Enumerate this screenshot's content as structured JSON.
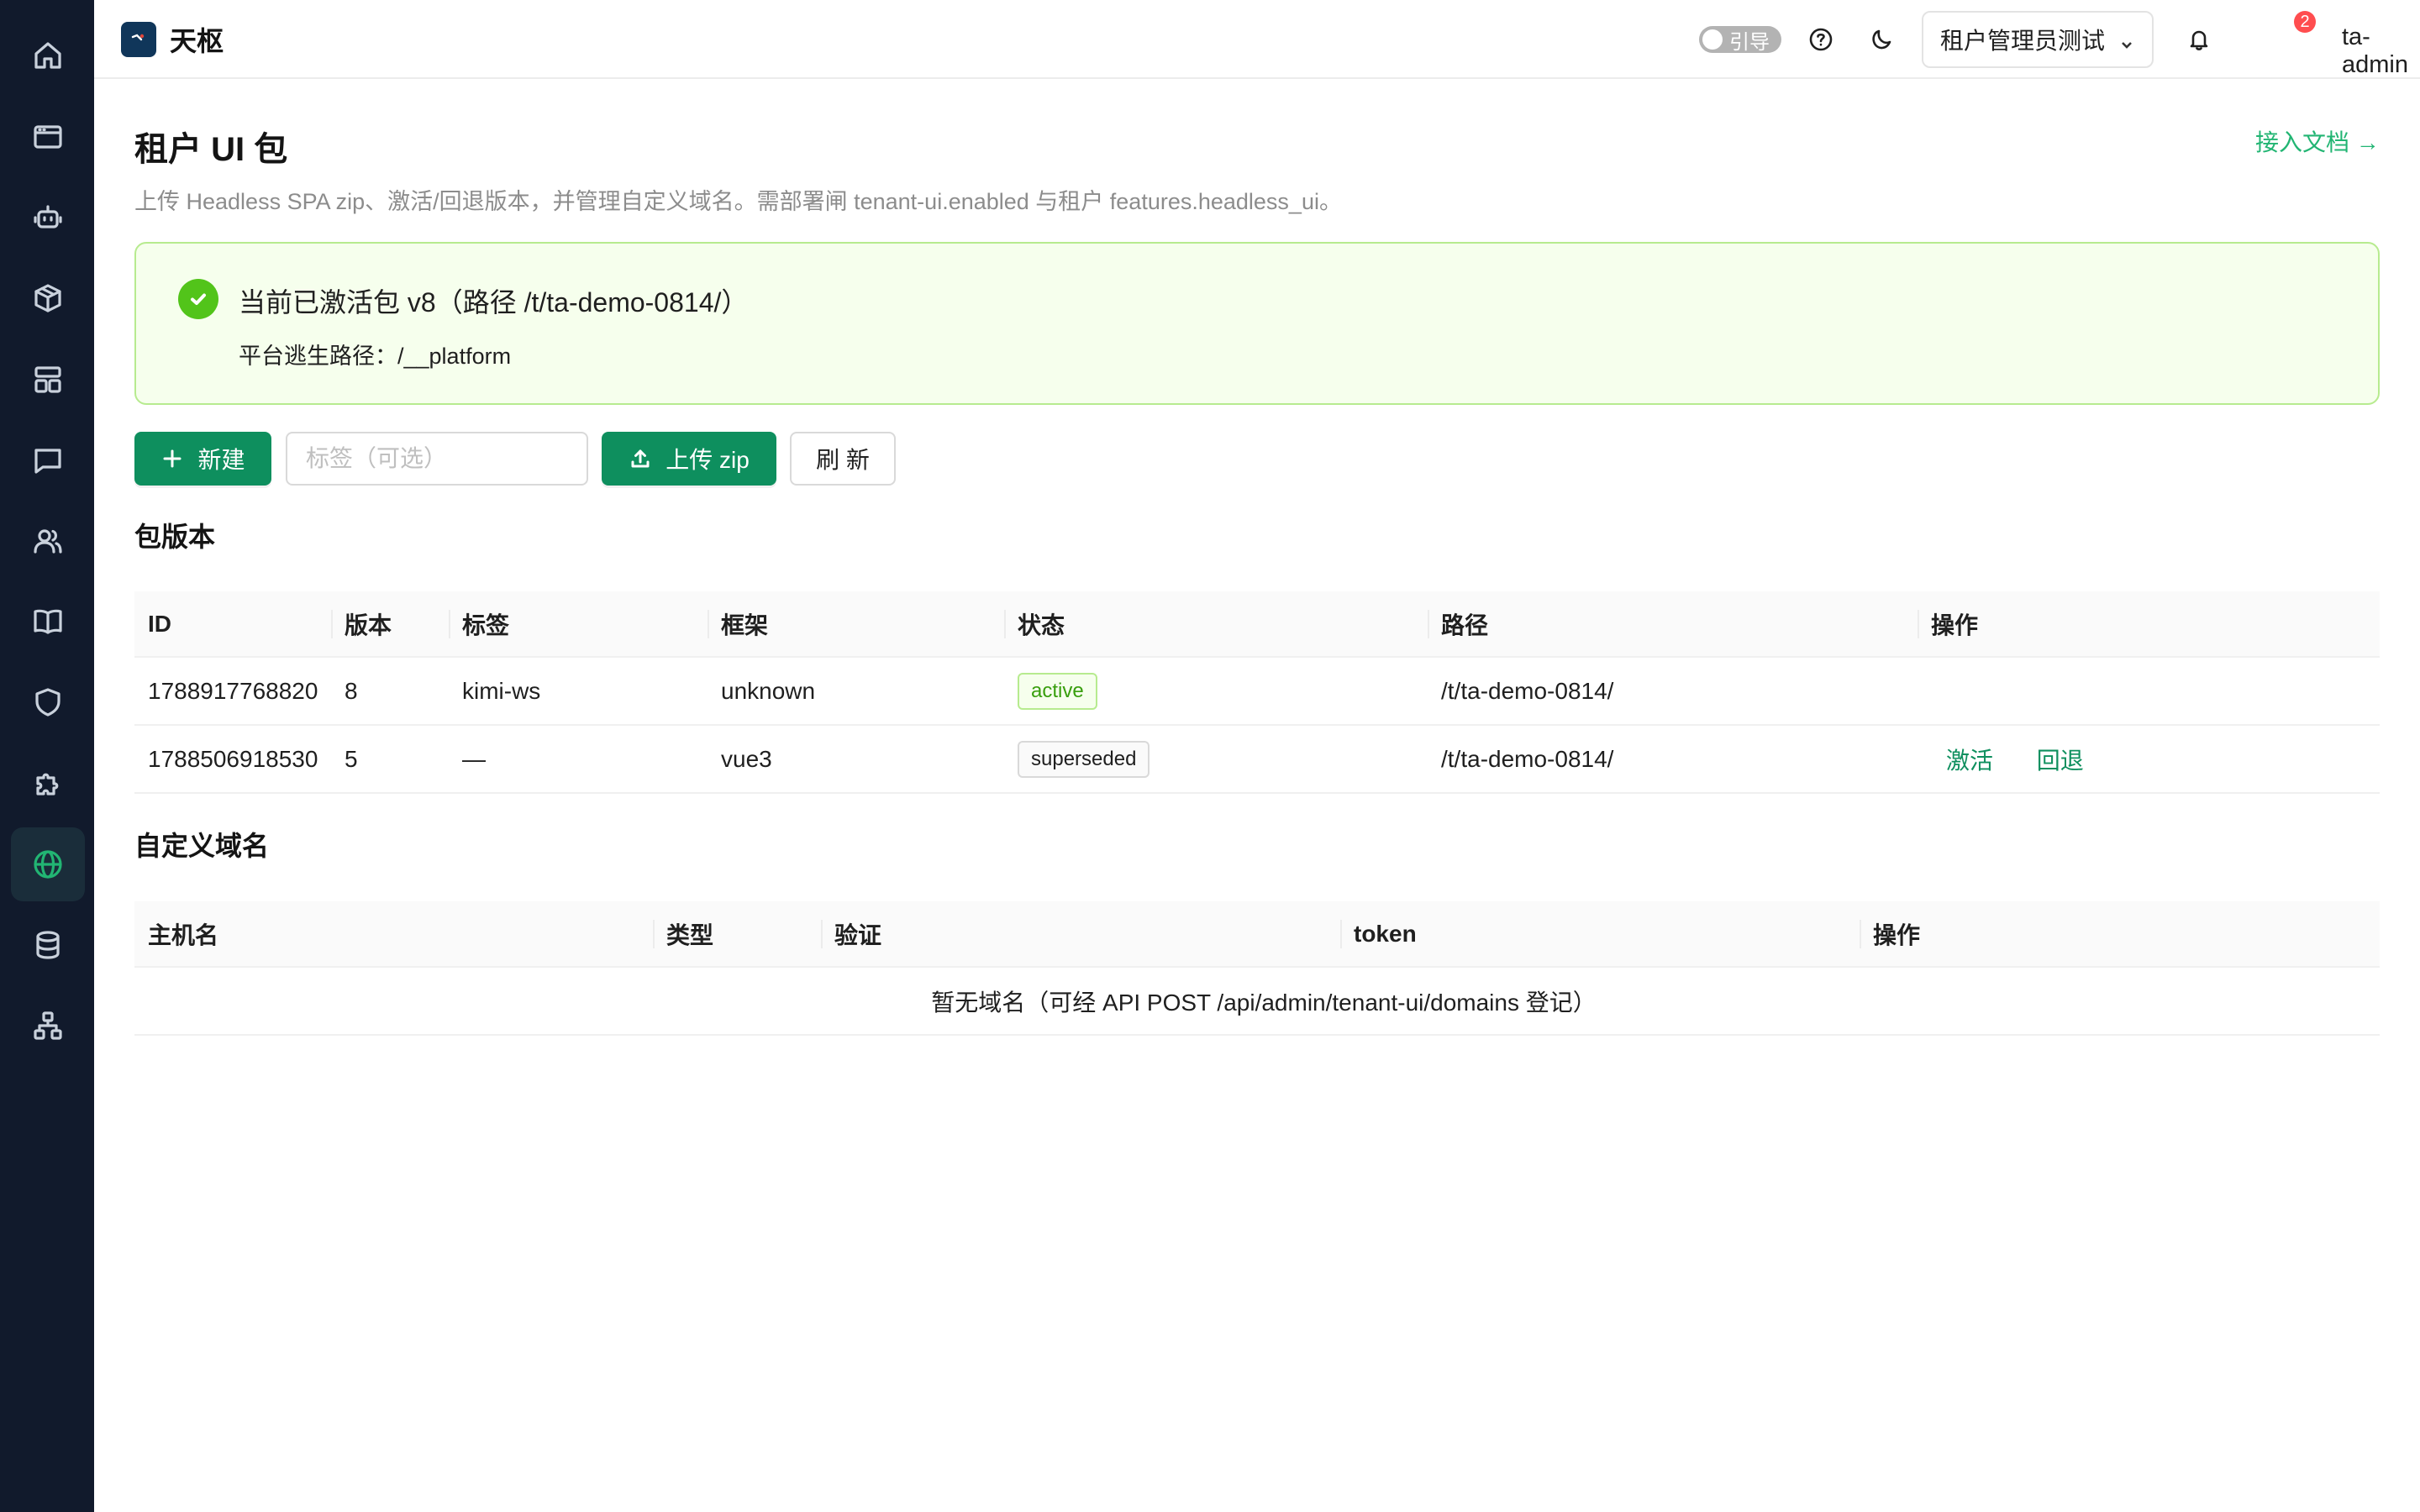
{
  "app": {
    "name": "天枢"
  },
  "sidebar": {
    "items": [
      {
        "icon": "home-icon"
      },
      {
        "icon": "browser-window-icon"
      },
      {
        "icon": "robot-icon"
      },
      {
        "icon": "package-box-icon"
      },
      {
        "icon": "layout-icon"
      },
      {
        "icon": "message-icon"
      },
      {
        "icon": "users-icon"
      },
      {
        "icon": "book-icon"
      },
      {
        "icon": "shield-icon"
      },
      {
        "icon": "puzzle-icon"
      },
      {
        "icon": "globe-icon",
        "active": true
      },
      {
        "icon": "database-icon"
      },
      {
        "icon": "sitemap-icon"
      }
    ]
  },
  "header": {
    "guide_label": "引导",
    "tenant_select": "租户管理员测试",
    "notification_count": "2",
    "user": "ta-admin"
  },
  "page": {
    "title": "租户 UI 包",
    "doc_link": "接入文档 →",
    "description": "上传 Headless SPA zip、激活/回退版本，并管理自定义域名。需部署闸 tenant-ui.enabled 与租户 features.headless_ui。"
  },
  "alert": {
    "title": "当前已激活包 v8（路径 /t/ta-demo-0814/）",
    "description": "平台逃生路径：/__platform"
  },
  "toolbar": {
    "new_label": "新建",
    "tag_placeholder": "标签（可选）",
    "upload_label": "上传 zip",
    "refresh_label": "刷 新"
  },
  "packages": {
    "section_title": "包版本",
    "columns": [
      "ID",
      "版本",
      "标签",
      "框架",
      "状态",
      "路径",
      "操作"
    ],
    "rows": [
      {
        "id": "1788917768820",
        "version": "8",
        "label": "kimi-ws",
        "framework": "unknown",
        "status": "active",
        "path": "/t/ta-demo-0814/",
        "actions": []
      },
      {
        "id": "1788506918530",
        "version": "5",
        "label": "—",
        "framework": "vue3",
        "status": "superseded",
        "path": "/t/ta-demo-0814/",
        "actions": [
          "激活",
          "回退"
        ]
      }
    ]
  },
  "domains": {
    "section_title": "自定义域名",
    "columns": [
      "主机名",
      "类型",
      "验证",
      "token",
      "操作"
    ],
    "empty_text": "暂无域名（可经 API POST /api/admin/tenant-ui/domains 登记）"
  },
  "colors": {
    "sidebar_bg": "#111a2c",
    "primary": "#0e8f5e",
    "link_green": "#22b573",
    "success_bg": "#f6ffed",
    "success_border": "#b7eb8f",
    "badge_red": "#ff4d4f"
  }
}
